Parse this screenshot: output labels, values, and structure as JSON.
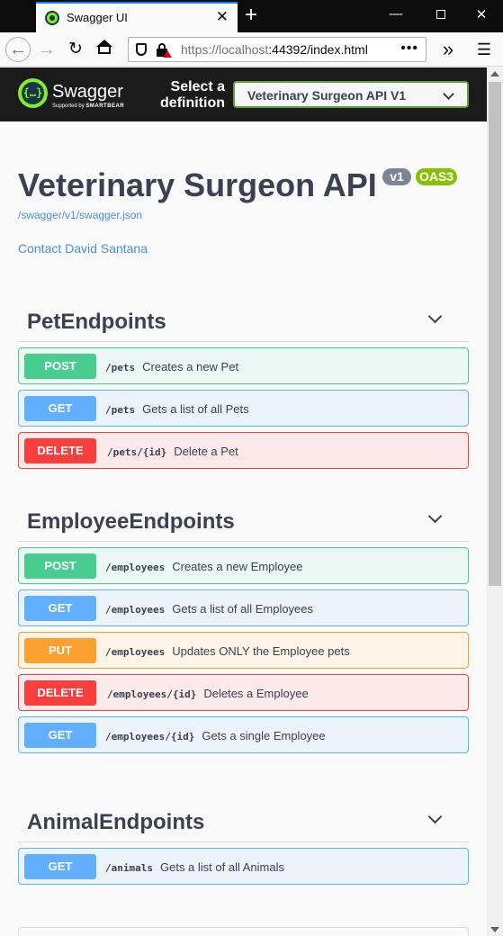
{
  "browser": {
    "tab_title": "Swagger UI",
    "url_host": "https://localhost",
    "url_port_path": ":44392/index.html"
  },
  "topbar": {
    "logo_text": "Swagger",
    "logo_sub_prefix": "Supported by",
    "logo_sub_brand": "SMARTBEAR",
    "select_label": "Select a definition",
    "selected_definition": "Veterinary Surgeon API V1"
  },
  "info": {
    "title": "Veterinary Surgeon API",
    "version": "v1",
    "oas": "OAS3",
    "spec_url": "/swagger/v1/swagger.json",
    "contact": "Contact David Santana"
  },
  "tags": [
    {
      "name": "PetEndpoints",
      "operations": [
        {
          "method": "POST",
          "path": "/pets",
          "summary": "Creates a new Pet"
        },
        {
          "method": "GET",
          "path": "/pets",
          "summary": "Gets a list of all Pets"
        },
        {
          "method": "DELETE",
          "path": "/pets/{id}",
          "summary": "Delete a Pet"
        }
      ]
    },
    {
      "name": "EmployeeEndpoints",
      "operations": [
        {
          "method": "POST",
          "path": "/employees",
          "summary": "Creates a new Employee"
        },
        {
          "method": "GET",
          "path": "/employees",
          "summary": "Gets a list of all Employees"
        },
        {
          "method": "PUT",
          "path": "/employees",
          "summary": "Updates ONLY the Employee pets"
        },
        {
          "method": "DELETE",
          "path": "/employees/{id}",
          "summary": "Deletes a Employee"
        },
        {
          "method": "GET",
          "path": "/employees/{id}",
          "summary": "Gets a single Employee"
        }
      ]
    },
    {
      "name": "AnimalEndpoints",
      "operations": [
        {
          "method": "GET",
          "path": "/animals",
          "summary": "Gets a list of all Animals"
        }
      ]
    }
  ]
}
